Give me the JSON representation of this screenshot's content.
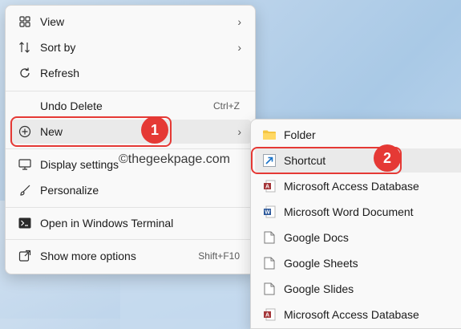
{
  "context_menu": {
    "items": [
      {
        "label": "View",
        "icon": "grid-icon",
        "submenu": true
      },
      {
        "label": "Sort by",
        "icon": "sort-icon",
        "submenu": true
      },
      {
        "label": "Refresh",
        "icon": "refresh-icon"
      },
      {
        "label": "Undo Delete",
        "icon": "undo-icon",
        "shortcut": "Ctrl+Z"
      },
      {
        "label": "New",
        "icon": "plus-circle-icon",
        "submenu": true
      },
      {
        "label": "Display settings",
        "icon": "display-icon"
      },
      {
        "label": "Personalize",
        "icon": "brush-icon"
      },
      {
        "label": "Open in Windows Terminal",
        "icon": "terminal-icon"
      },
      {
        "label": "Show more options",
        "icon": "share-icon",
        "shortcut": "Shift+F10"
      }
    ]
  },
  "new_submenu": {
    "items": [
      {
        "label": "Folder",
        "icon": "folder-icon"
      },
      {
        "label": "Shortcut",
        "icon": "shortcut-icon"
      },
      {
        "label": "Microsoft Access Database",
        "icon": "access-icon"
      },
      {
        "label": "Microsoft Word Document",
        "icon": "word-icon"
      },
      {
        "label": "Google Docs",
        "icon": "document-icon"
      },
      {
        "label": "Google Sheets",
        "icon": "document-icon"
      },
      {
        "label": "Google Slides",
        "icon": "document-icon"
      },
      {
        "label": "Microsoft Access Database",
        "icon": "access-icon"
      }
    ]
  },
  "annotations": {
    "badge_1": "1",
    "badge_2": "2",
    "color": "#e53935"
  },
  "watermark": "©thegeekpage.com",
  "arrow_glyph": "›"
}
